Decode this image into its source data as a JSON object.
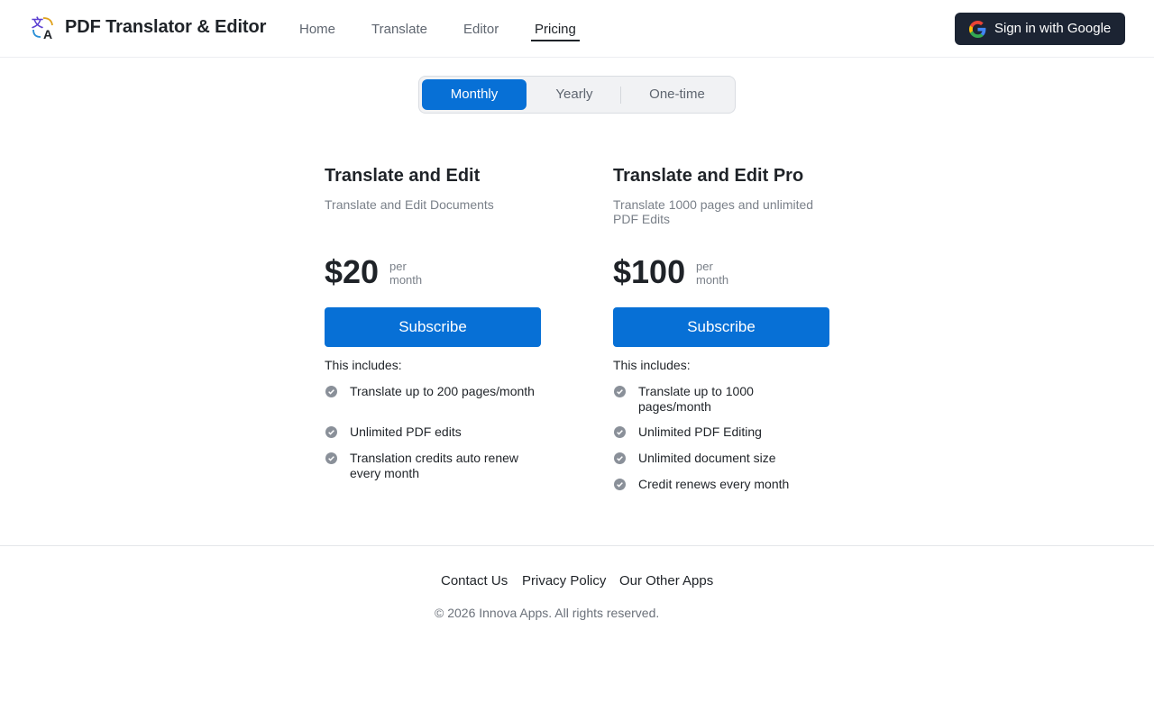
{
  "header": {
    "app_title": "PDF Translator & Editor",
    "logo_icon": "translate-icon",
    "nav": [
      {
        "label": "Home"
      },
      {
        "label": "Translate"
      },
      {
        "label": "Editor"
      },
      {
        "label": "Pricing",
        "active": true
      }
    ],
    "signin_label": "Sign in with Google",
    "signin_icon": "google-icon"
  },
  "billing_toggle": {
    "options": [
      {
        "label": "Monthly",
        "selected": true
      },
      {
        "label": "Yearly"
      },
      {
        "label": "One-time"
      }
    ]
  },
  "plans": [
    {
      "name": "Translate and Edit",
      "description": "Translate and Edit Documents",
      "price": "$20",
      "per_1": "per",
      "per_2": "month",
      "button_label": "Subscribe",
      "includes_label": "This includes:",
      "features": [
        "Translate up to 200 pages/month",
        "Unlimited PDF edits",
        "Translation credits auto renew every month"
      ]
    },
    {
      "name": "Translate and Edit Pro",
      "description": "Translate 1000 pages and unlimited PDF Edits",
      "price": "$100",
      "per_1": "per",
      "per_2": "month",
      "button_label": "Subscribe",
      "includes_label": "This includes:",
      "features": [
        "Translate up to 1000 pages/month",
        "Unlimited PDF Editing",
        "Unlimited document size",
        "Credit renews every month"
      ]
    }
  ],
  "footer": {
    "links": [
      "Contact Us",
      "Privacy Policy",
      "Our Other Apps"
    ],
    "copyright": "© 2026 Innova Apps. All rights reserved."
  },
  "colors": {
    "primary": "#0770d6",
    "signin_bg": "#1c2433",
    "check_icon": "#8a9099"
  }
}
